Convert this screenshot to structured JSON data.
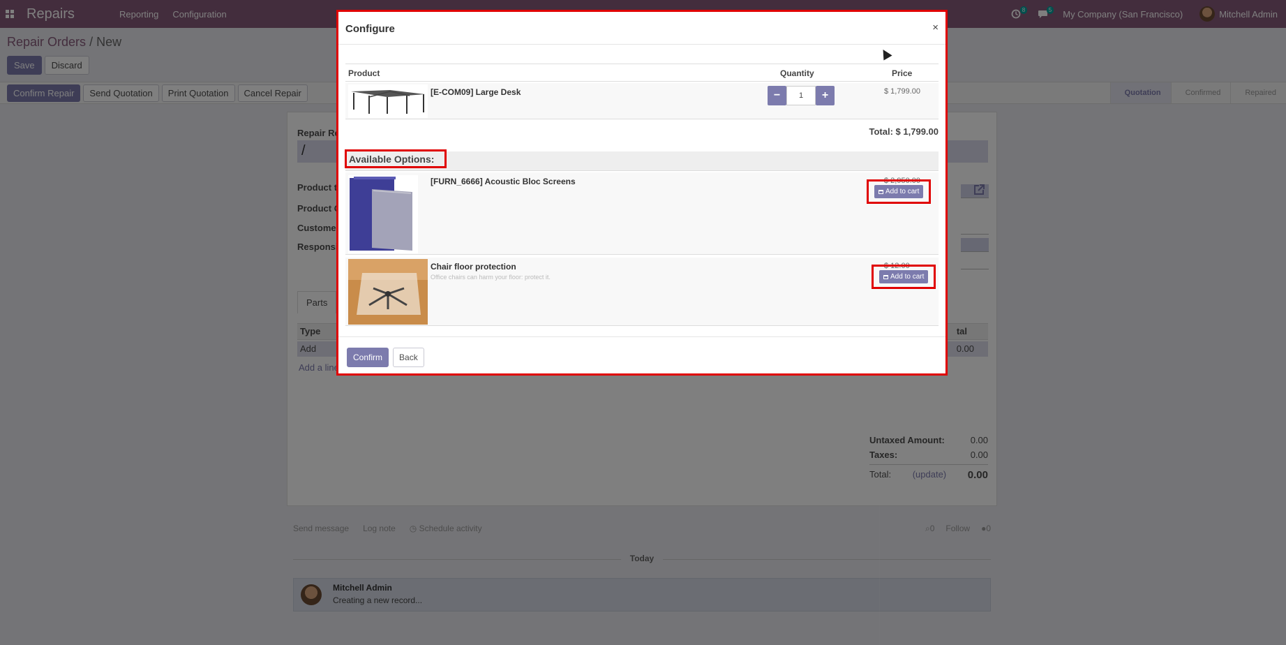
{
  "navbar": {
    "brand": "Repairs",
    "menus": [
      "Reporting",
      "Configuration"
    ],
    "activity_count": "8",
    "messages_count": "5",
    "company": "My Company (San Francisco)",
    "user": "Mitchell Admin",
    "color": "#875a7b"
  },
  "breadcrumb": {
    "parent": "Repair Orders",
    "separator": "/",
    "current": "New"
  },
  "form_buttons": {
    "save": "Save",
    "discard": "Discard"
  },
  "status_actions": [
    "Confirm Repair",
    "Send Quotation",
    "Print Quotation",
    "Cancel Repair"
  ],
  "stages": [
    {
      "label": "Quotation",
      "active": true
    },
    {
      "label": "Confirmed",
      "active": false
    },
    {
      "label": "Repaired",
      "active": false
    }
  ],
  "form": {
    "ref_label": "Repair Ref",
    "ref_value": "/",
    "labels": [
      "Product to",
      "Product Q",
      "Customer",
      "Responsib"
    ],
    "tab": "Parts",
    "table_head": "Type",
    "table_head_right": "tal",
    "row_type": "Add",
    "row_amount": "0.00",
    "add_line": "Add a line",
    "untaxed_label": "Untaxed Amount:",
    "untaxed_value": "0.00",
    "taxes_label": "Taxes:",
    "taxes_value": "0.00",
    "total_label": "Total:",
    "update_label": "(update)",
    "total_value": "0.00"
  },
  "chatter": {
    "send_message": "Send message",
    "log_note": "Log note",
    "schedule_activity": "Schedule activity",
    "attachments": "0",
    "follow": "Follow",
    "followers": "0",
    "today": "Today",
    "author": "Mitchell Admin",
    "body": "Creating a new record..."
  },
  "modal": {
    "title": "Configure",
    "close": "×",
    "columns": {
      "product": "Product",
      "quantity": "Quantity",
      "price": "Price"
    },
    "main_product": {
      "name": "[E-COM09] Large Desk",
      "quantity": "1",
      "price": "$ 1,799.00",
      "thumb": "desk-image"
    },
    "total": "Total: $ 1,799.00",
    "options_title": "Available Options:",
    "options": [
      {
        "name": "[FURN_6666] Acoustic Bloc Screens",
        "description": "",
        "price": "$ 2,950.00",
        "button": "Add to cart",
        "thumb": "screens-image"
      },
      {
        "name": "Chair floor protection",
        "description": "Office chairs can harm your floor: protect it.",
        "price": "$ 12.00",
        "button": "Add to cart",
        "thumb": "floor-mat-image"
      }
    ],
    "confirm": "Confirm",
    "back": "Back",
    "highlight_color": "#e00000"
  }
}
